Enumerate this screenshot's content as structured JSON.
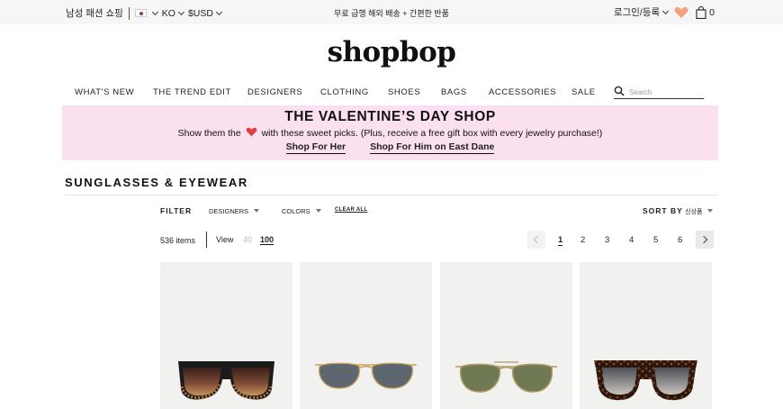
{
  "topbar": {
    "mens_link": "남성 패션 쇼핑",
    "language": "KO",
    "currency": "$USD",
    "promo": "무료 급행 해외 배송 + 간편한 반품",
    "login": "로그인/등록",
    "bag_count": "0"
  },
  "logo": "shopbop",
  "nav": {
    "items": [
      "WHAT'S NEW",
      "THE TREND EDIT",
      "DESIGNERS",
      "CLOTHING",
      "SHOES",
      "BAGS",
      "ACCESSORIES",
      "SALE"
    ],
    "search_placeholder": "Search"
  },
  "banner": {
    "title": "THE VALENTINE’S DAY SHOP",
    "line_before": "Show them the",
    "line_after": "with these sweet picks. (Plus, receive a free gift box with every jewelry purchase!)",
    "link_her": "Shop For Her",
    "link_him": "Shop For Him on East Dane",
    "bg_color": "#fbe0f0",
    "heart_color": "#e0413f"
  },
  "section": {
    "title": "SUNGLASSES & EYEWEAR"
  },
  "filters": {
    "filter_label": "FILTER",
    "designers": "DESIGNERS",
    "colors": "COLORS",
    "clear_all": "CLEAR ALL",
    "sort_label": "SORT BY",
    "sort_value": "신상품"
  },
  "results": {
    "count": "536 items",
    "view_label": "View",
    "view_40": "40",
    "view_100": "100"
  },
  "pagination": {
    "pages": [
      "1",
      "2",
      "3",
      "4",
      "5",
      "6"
    ],
    "active": "1"
  },
  "products": [
    {
      "icon": "sunglasses-flattop-gradient"
    },
    {
      "icon": "sunglasses-aviator-grey"
    },
    {
      "icon": "sunglasses-aviator-green"
    },
    {
      "icon": "sunglasses-tortoise-square"
    }
  ],
  "colors": {
    "accent_heart": "#f5a07a",
    "text": "#222222"
  }
}
